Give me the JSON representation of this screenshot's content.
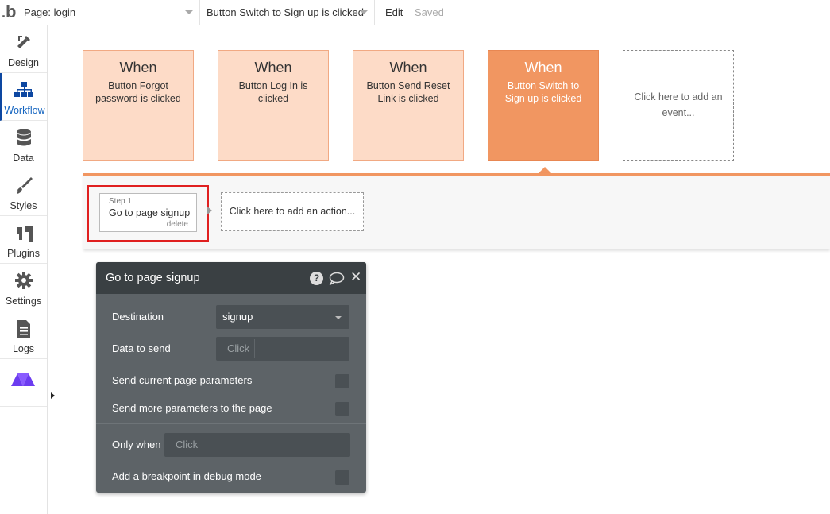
{
  "topbar": {
    "logo": "b",
    "page_select": "Page: login",
    "event_select": "Button Switch to Sign up is clicked",
    "edit": "Edit",
    "saved": "Saved"
  },
  "sidebar": {
    "items": [
      {
        "label": "Design",
        "icon": "design-icon"
      },
      {
        "label": "Workflow",
        "icon": "workflow-icon"
      },
      {
        "label": "Data",
        "icon": "database-icon"
      },
      {
        "label": "Styles",
        "icon": "brush-icon"
      },
      {
        "label": "Plugins",
        "icon": "plug-icon"
      },
      {
        "label": "Settings",
        "icon": "gear-icon"
      },
      {
        "label": "Logs",
        "icon": "document-icon"
      },
      {
        "label": "",
        "icon": "brand-logo-icon"
      }
    ]
  },
  "events": [
    {
      "when": "When",
      "desc": "Button Forgot password is clicked"
    },
    {
      "when": "When",
      "desc": "Button Log In is clicked"
    },
    {
      "when": "When",
      "desc": "Button Send Reset Link is clicked"
    },
    {
      "when": "When",
      "desc": "Button Switch to Sign up is clicked"
    }
  ],
  "add_event": "Click here to add an event...",
  "step": {
    "number": "Step 1",
    "name": "Go to page signup",
    "delete": "delete"
  },
  "add_action": "Click here to add an action...",
  "panel": {
    "title": "Go to page signup",
    "destination_label": "Destination",
    "destination_value": "signup",
    "data_to_send_label": "Data to send",
    "data_to_send_placeholder": "Click",
    "send_current_label": "Send current page parameters",
    "send_more_label": "Send more parameters to the page",
    "only_when_label": "Only when",
    "only_when_placeholder": "Click",
    "breakpoint_label": "Add a breakpoint in debug mode"
  },
  "colors": {
    "event_card": "#fddbc7",
    "event_card_active": "#f19661",
    "highlight": "#e02020",
    "panel_bg": "#5d6367",
    "panel_header": "#3a4043",
    "active_nav": "#1565c0"
  }
}
